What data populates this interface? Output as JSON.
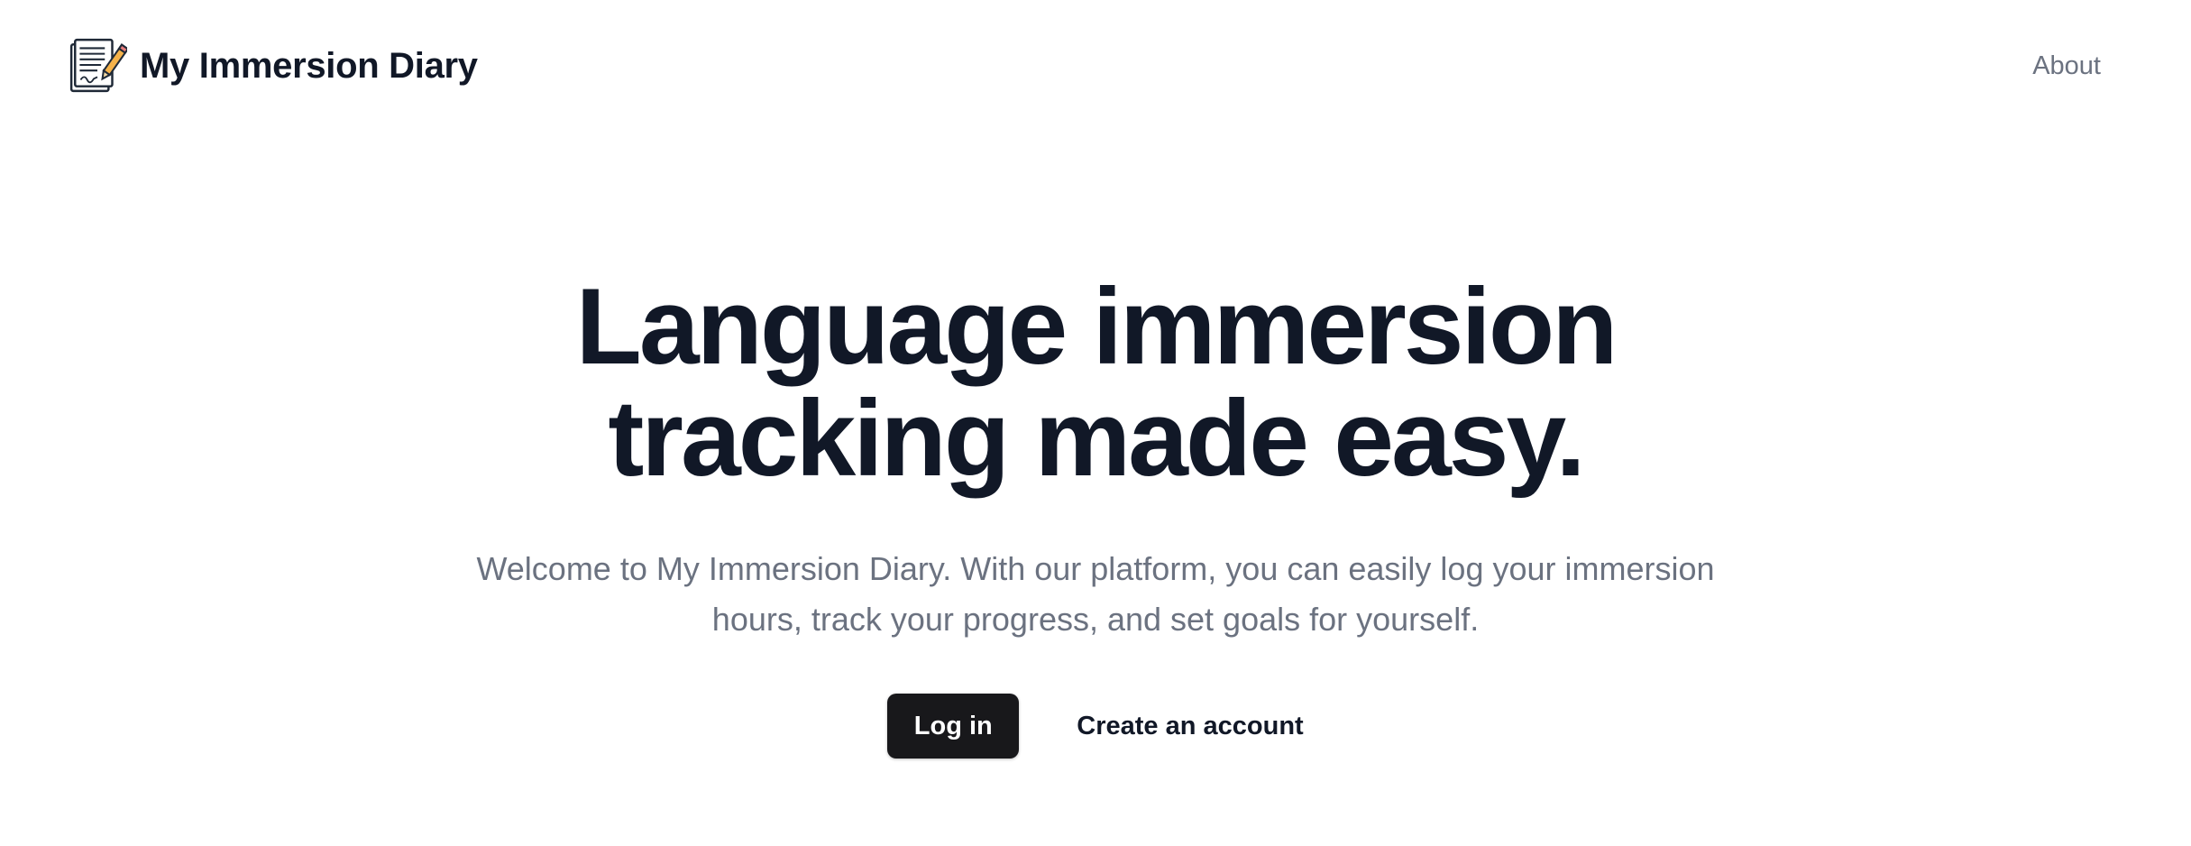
{
  "header": {
    "brand_name": "My Immersion Diary",
    "brand_icon": "diary-pencil-icon",
    "nav": {
      "about_label": "About"
    }
  },
  "hero": {
    "title_line1": "Language immersion",
    "title_line2": "tracking made easy.",
    "subtitle_line1": "Welcome to My Immersion Diary. With our platform, you can easily log your immersion",
    "subtitle_line2": "hours, track your progress, and set goals for yourself."
  },
  "actions": {
    "login_label": "Log in",
    "create_account_label": "Create an account"
  },
  "colors": {
    "text_primary": "#111827",
    "text_muted": "#6b7280",
    "button_dark": "#18181b",
    "background": "#ffffff"
  }
}
